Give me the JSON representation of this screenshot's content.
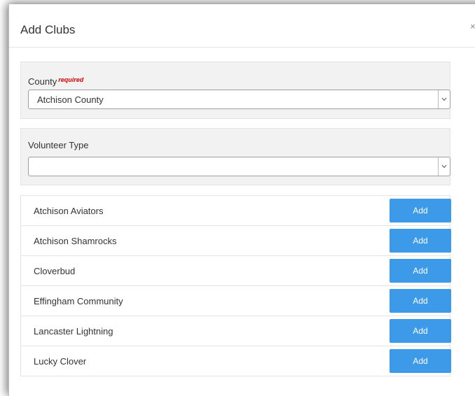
{
  "modal": {
    "title": "Add Clubs",
    "close_label": "×"
  },
  "county": {
    "label": "County",
    "required_label": "required",
    "value": "Atchison County"
  },
  "volunteer_type": {
    "label": "Volunteer Type",
    "value": ""
  },
  "clubs": [
    {
      "name": "Atchison Aviators",
      "button": "Add"
    },
    {
      "name": "Atchison Shamrocks",
      "button": "Add"
    },
    {
      "name": "Cloverbud",
      "button": "Add"
    },
    {
      "name": "Effingham Community",
      "button": "Add"
    },
    {
      "name": "Lancaster Lightning",
      "button": "Add"
    },
    {
      "name": "Lucky Clover",
      "button": "Add"
    }
  ],
  "colors": {
    "accent": "#3d9ae8",
    "required": "#e00000",
    "panel_bg": "#f2f2f2"
  }
}
